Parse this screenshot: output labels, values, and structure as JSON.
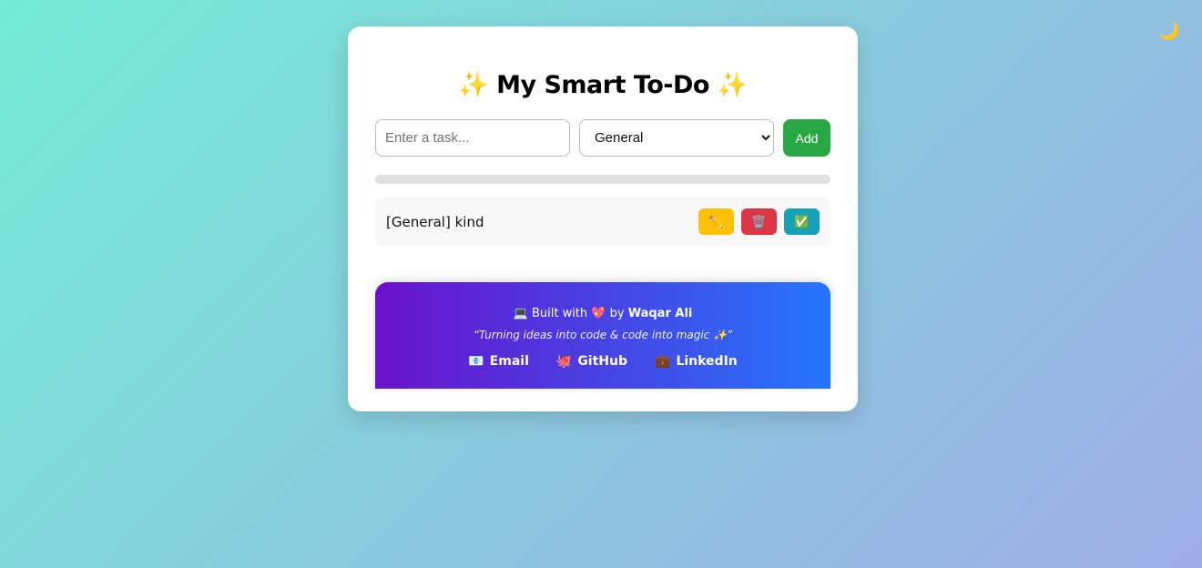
{
  "theme_toggle": {
    "icon": "crescent-moon-icon",
    "glyph": "🌙"
  },
  "header": {
    "title": "✨ My Smart To-Do ✨"
  },
  "form": {
    "task_placeholder": "Enter a task...",
    "task_value": "",
    "category_selected": "General",
    "add_label": "Add"
  },
  "progress": {
    "fraction": 0.0
  },
  "tasks": [
    {
      "text": "[General] kind",
      "edit_glyph": "✏️",
      "delete_glyph": "🗑️",
      "done_glyph": "✅"
    }
  ],
  "footer": {
    "laptop_glyph": "💻",
    "built_with": "Built with",
    "heart_glyph": "💖",
    "by": "by",
    "author": "Waqar Ali",
    "quote": "“Turning ideas into code & code into magic ✨”",
    "links": [
      {
        "glyph": "📧",
        "label": "Email"
      },
      {
        "glyph": "🐙",
        "label": "GitHub"
      },
      {
        "glyph": "💼",
        "label": "LinkedIn"
      }
    ]
  },
  "colors": {
    "add_button": "#28a745",
    "edit_button": "#ffc107",
    "delete_button": "#dc3545",
    "done_button": "#17a2b8",
    "footer_gradient_start": "#6a11cb",
    "footer_gradient_end": "#2575fc"
  }
}
